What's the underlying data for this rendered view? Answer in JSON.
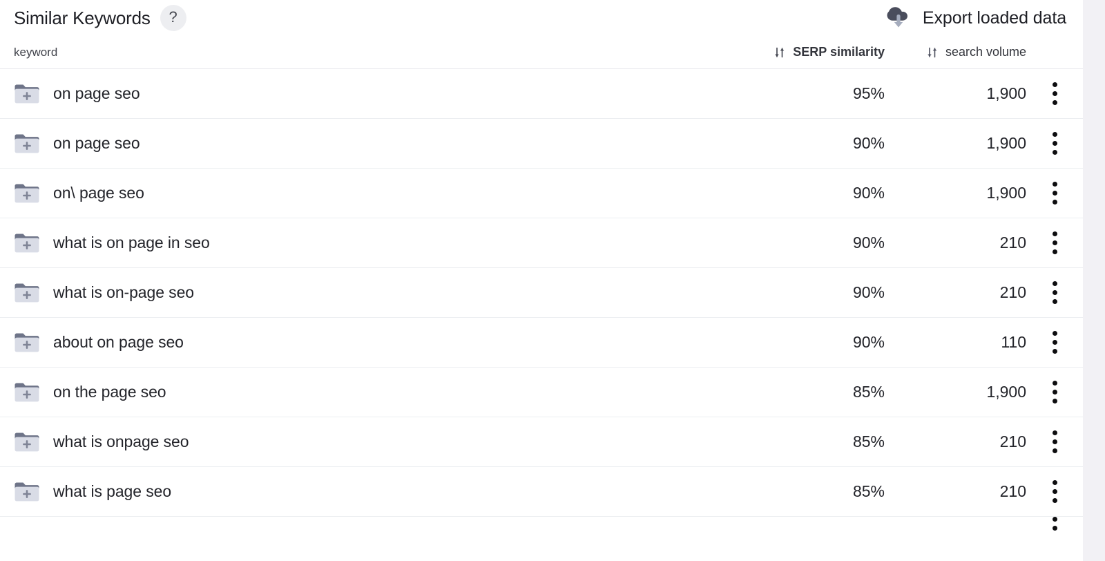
{
  "header": {
    "title": "Similar Keywords",
    "help_icon": "question-mark-icon",
    "help_label": "?",
    "export_label": "Export loaded data",
    "export_icon": "cloud-download-icon"
  },
  "table": {
    "columns": {
      "keyword": "keyword",
      "serp_similarity": "SERP similarity",
      "search_volume": "search volume"
    },
    "sort_icon": "sort-arrows-icon",
    "active_sort_column": "serp_similarity",
    "row_icon": "add-to-folder-icon",
    "row_menu_icon": "kebab-menu-icon",
    "rows": [
      {
        "keyword": "on page seo",
        "serp_similarity": "95%",
        "search_volume": "1,900"
      },
      {
        "keyword": "on page seo",
        "serp_similarity": "90%",
        "search_volume": "1,900"
      },
      {
        "keyword": "on\\ page seo",
        "serp_similarity": "90%",
        "search_volume": "1,900"
      },
      {
        "keyword": "what is on page in seo",
        "serp_similarity": "90%",
        "search_volume": "210"
      },
      {
        "keyword": "what is on-page seo",
        "serp_similarity": "90%",
        "search_volume": "210"
      },
      {
        "keyword": "about on page seo",
        "serp_similarity": "90%",
        "search_volume": "110"
      },
      {
        "keyword": "on the page seo",
        "serp_similarity": "85%",
        "search_volume": "1,900"
      },
      {
        "keyword": "what is onpage seo",
        "serp_similarity": "85%",
        "search_volume": "210"
      },
      {
        "keyword": "what is page seo",
        "serp_similarity": "85%",
        "search_volume": "210"
      }
    ]
  },
  "colors": {
    "text": "#23242a",
    "icon_dark": "#4a4d5c",
    "icon_light": "#a5acbd",
    "folder_body": "#d9dce6",
    "divider": "#eceef1",
    "gutter": "#f2f1f5"
  }
}
